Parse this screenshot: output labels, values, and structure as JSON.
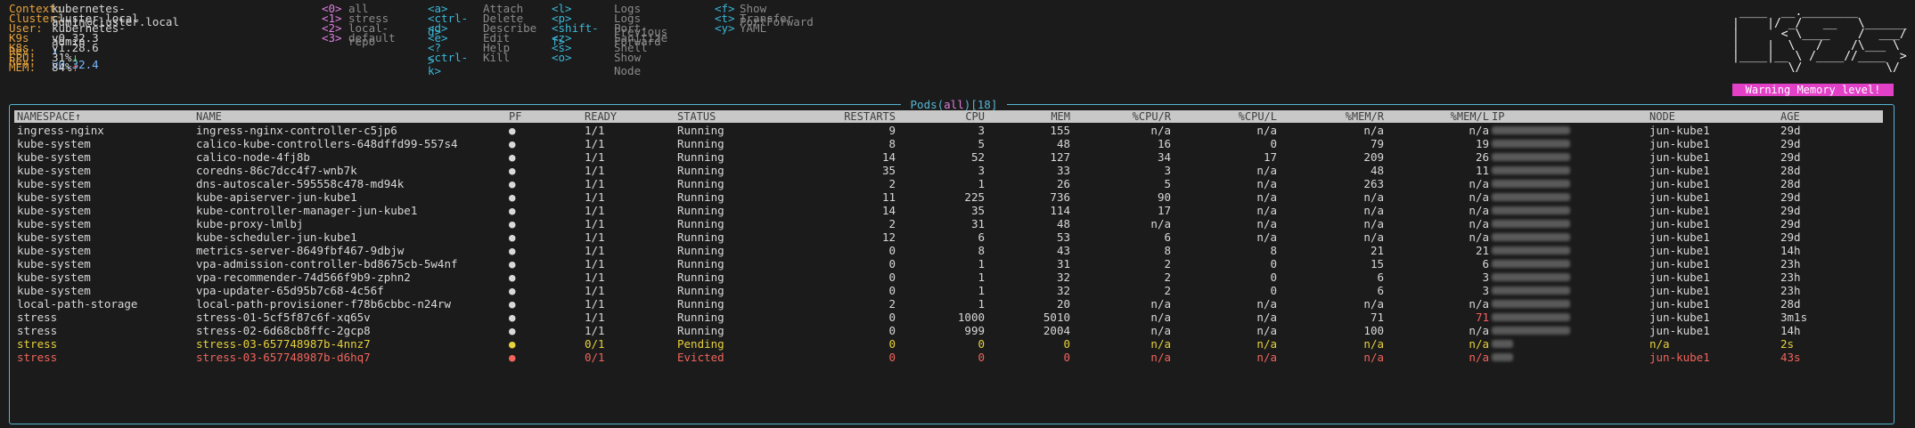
{
  "header": {
    "info": [
      {
        "key": "Context:",
        "value": "kubernetes-admin@cluster.local"
      },
      {
        "key": "Cluster:",
        "value": "cluster.local"
      },
      {
        "key": "User:",
        "value": "kubernetes-admin"
      },
      {
        "key": "K9s Rev:",
        "value": "v0.32.3",
        "extra_glyph": "⬇",
        "extra": "v0.32.4"
      },
      {
        "key": "K8s Rev:",
        "value": "v1.28.6"
      },
      {
        "key": "CPU:",
        "value": "31%",
        "trend": "↓"
      },
      {
        "key": "MEM:",
        "value": "84%",
        "trend": "↑"
      }
    ],
    "namespaces": [
      {
        "key": "<0>",
        "label": "all"
      },
      {
        "key": "<1>",
        "label": "stress"
      },
      {
        "key": "<2>",
        "label": "local-repo"
      },
      {
        "key": "<3>",
        "label": "default"
      }
    ],
    "actions1": [
      {
        "key": "<a>",
        "label": "Attach"
      },
      {
        "key": "<ctrl-d>",
        "label": "Delete"
      },
      {
        "key": "<d>",
        "label": "Describe"
      },
      {
        "key": "<e>",
        "label": "Edit"
      },
      {
        "key": "<?>",
        "label": "Help"
      },
      {
        "key": "<ctrl-k>",
        "label": "Kill"
      }
    ],
    "actions2": [
      {
        "key": "<l>",
        "label": "Logs"
      },
      {
        "key": "<p>",
        "label": "Logs Previous"
      },
      {
        "key": "<shift-f>",
        "label": "Port-Forward"
      },
      {
        "key": "<z>",
        "label": "Sanitize"
      },
      {
        "key": "<s>",
        "label": "Shell"
      },
      {
        "key": "<o>",
        "label": "Show Node"
      }
    ],
    "actions3": [
      {
        "key": "<f>",
        "label": "Show PortForward"
      },
      {
        "key": "<t>",
        "label": "Transfer"
      },
      {
        "key": "<y>",
        "label": "YAML"
      }
    ],
    "logo_lines": [
      " ____  __.________        ",
      "|    |/ _/   __   \\______ ",
      "|      < \\____    /  ___/ ",
      "|    |  \\   /    /\\___ \\  ",
      "|____|__ \\ /____//____  > ",
      "        \\/            \\/  "
    ],
    "warning": "Warning Memory level!"
  },
  "table": {
    "title_pre": " Pods(",
    "title_ns": "all",
    "title_post": ")[18] ",
    "columns": [
      "NAMESPACE↑",
      "NAME",
      "PF",
      "READY",
      "STATUS",
      "RESTARTS",
      "CPU",
      "MEM",
      "%CPU/R",
      "%CPU/L",
      "%MEM/R",
      "%MEM/L",
      "IP",
      "NODE",
      "AGE"
    ],
    "rows": [
      {
        "ns": "ingress-nginx",
        "name": "ingress-nginx-controller-c5jp6",
        "pf": "●",
        "ready": "1/1",
        "status": "Running",
        "restarts": "9",
        "cpu": "3",
        "mem": "155",
        "cpur": "n/a",
        "cpul": "n/a",
        "memr": "n/a",
        "meml": "n/a",
        "node": "jun-kube1",
        "age": "29d",
        "state": "ok"
      },
      {
        "ns": "kube-system",
        "name": "calico-kube-controllers-648dffd99-557s4",
        "pf": "●",
        "ready": "1/1",
        "status": "Running",
        "restarts": "8",
        "cpu": "5",
        "mem": "48",
        "cpur": "16",
        "cpul": "0",
        "memr": "79",
        "meml": "19",
        "node": "jun-kube1",
        "age": "29d",
        "state": "ok"
      },
      {
        "ns": "kube-system",
        "name": "calico-node-4fj8b",
        "pf": "●",
        "ready": "1/1",
        "status": "Running",
        "restarts": "14",
        "cpu": "52",
        "mem": "127",
        "cpur": "34",
        "cpul": "17",
        "memr": "209",
        "meml": "26",
        "node": "jun-kube1",
        "age": "29d",
        "state": "ok"
      },
      {
        "ns": "kube-system",
        "name": "coredns-86c7dcc4f7-wnb7k",
        "pf": "●",
        "ready": "1/1",
        "status": "Running",
        "restarts": "35",
        "cpu": "3",
        "mem": "33",
        "cpur": "3",
        "cpul": "n/a",
        "memr": "48",
        "meml": "11",
        "node": "jun-kube1",
        "age": "28d",
        "state": "ok"
      },
      {
        "ns": "kube-system",
        "name": "dns-autoscaler-595558c478-md94k",
        "pf": "●",
        "ready": "1/1",
        "status": "Running",
        "restarts": "2",
        "cpu": "1",
        "mem": "26",
        "cpur": "5",
        "cpul": "n/a",
        "memr": "263",
        "meml": "n/a",
        "node": "jun-kube1",
        "age": "28d",
        "state": "ok"
      },
      {
        "ns": "kube-system",
        "name": "kube-apiserver-jun-kube1",
        "pf": "●",
        "ready": "1/1",
        "status": "Running",
        "restarts": "11",
        "cpu": "225",
        "mem": "736",
        "cpur": "90",
        "cpul": "n/a",
        "memr": "n/a",
        "meml": "n/a",
        "node": "jun-kube1",
        "age": "29d",
        "state": "ok"
      },
      {
        "ns": "kube-system",
        "name": "kube-controller-manager-jun-kube1",
        "pf": "●",
        "ready": "1/1",
        "status": "Running",
        "restarts": "14",
        "cpu": "35",
        "mem": "114",
        "cpur": "17",
        "cpul": "n/a",
        "memr": "n/a",
        "meml": "n/a",
        "node": "jun-kube1",
        "age": "29d",
        "state": "ok"
      },
      {
        "ns": "kube-system",
        "name": "kube-proxy-lmlbj",
        "pf": "●",
        "ready": "1/1",
        "status": "Running",
        "restarts": "2",
        "cpu": "31",
        "mem": "48",
        "cpur": "n/a",
        "cpul": "n/a",
        "memr": "n/a",
        "meml": "n/a",
        "node": "jun-kube1",
        "age": "29d",
        "state": "ok"
      },
      {
        "ns": "kube-system",
        "name": "kube-scheduler-jun-kube1",
        "pf": "●",
        "ready": "1/1",
        "status": "Running",
        "restarts": "12",
        "cpu": "6",
        "mem": "53",
        "cpur": "6",
        "cpul": "n/a",
        "memr": "n/a",
        "meml": "n/a",
        "node": "jun-kube1",
        "age": "29d",
        "state": "ok"
      },
      {
        "ns": "kube-system",
        "name": "metrics-server-8649fbf467-9dbjw",
        "pf": "●",
        "ready": "1/1",
        "status": "Running",
        "restarts": "0",
        "cpu": "8",
        "mem": "43",
        "cpur": "8",
        "cpul": "8",
        "memr": "21",
        "meml": "21",
        "node": "jun-kube1",
        "age": "14h",
        "state": "ok"
      },
      {
        "ns": "kube-system",
        "name": "vpa-admission-controller-bd8675cb-5w4nf",
        "pf": "●",
        "ready": "1/1",
        "status": "Running",
        "restarts": "0",
        "cpu": "1",
        "mem": "31",
        "cpur": "2",
        "cpul": "0",
        "memr": "15",
        "meml": "6",
        "node": "jun-kube1",
        "age": "23h",
        "state": "ok"
      },
      {
        "ns": "kube-system",
        "name": "vpa-recommender-74d566f9b9-zphn2",
        "pf": "●",
        "ready": "1/1",
        "status": "Running",
        "restarts": "0",
        "cpu": "1",
        "mem": "32",
        "cpur": "2",
        "cpul": "0",
        "memr": "6",
        "meml": "3",
        "node": "jun-kube1",
        "age": "23h",
        "state": "ok"
      },
      {
        "ns": "kube-system",
        "name": "vpa-updater-65d95b7c68-4c56f",
        "pf": "●",
        "ready": "1/1",
        "status": "Running",
        "restarts": "0",
        "cpu": "1",
        "mem": "32",
        "cpur": "2",
        "cpul": "0",
        "memr": "6",
        "meml": "3",
        "node": "jun-kube1",
        "age": "23h",
        "state": "ok"
      },
      {
        "ns": "local-path-storage",
        "name": "local-path-provisioner-f78b6cbbc-n24rw",
        "pf": "●",
        "ready": "1/1",
        "status": "Running",
        "restarts": "2",
        "cpu": "1",
        "mem": "20",
        "cpur": "n/a",
        "cpul": "n/a",
        "memr": "n/a",
        "meml": "n/a",
        "node": "jun-kube1",
        "age": "28d",
        "state": "ok"
      },
      {
        "ns": "stress",
        "name": "stress-01-5cf5f87c6f-xq65v",
        "pf": "●",
        "ready": "1/1",
        "status": "Running",
        "restarts": "0",
        "cpu": "1000",
        "mem": "5010",
        "cpur": "n/a",
        "cpul": "n/a",
        "memr": "71",
        "meml": "71",
        "node": "jun-kube1",
        "age": "3m1s",
        "state": "ok",
        "meml_hot": true
      },
      {
        "ns": "stress",
        "name": "stress-02-6d68cb8ffc-2gcp8",
        "pf": "●",
        "ready": "1/1",
        "status": "Running",
        "restarts": "0",
        "cpu": "999",
        "mem": "2004",
        "cpur": "n/a",
        "cpul": "n/a",
        "memr": "100",
        "meml": "n/a",
        "node": "jun-kube1",
        "age": "14h",
        "state": "ok"
      },
      {
        "ns": "stress",
        "name": "stress-03-657748987b-4nnz7",
        "pf": "●",
        "ready": "0/1",
        "status": "Pending",
        "restarts": "0",
        "cpu": "0",
        "mem": "0",
        "cpur": "n/a",
        "cpul": "n/a",
        "memr": "n/a",
        "meml": "n/a",
        "node": "n/a",
        "age": "2s",
        "state": "pending"
      },
      {
        "ns": "stress",
        "name": "stress-03-657748987b-d6hq7",
        "pf": "●",
        "ready": "0/1",
        "status": "Evicted",
        "restarts": "0",
        "cpu": "0",
        "mem": "0",
        "cpur": "n/a",
        "cpul": "n/a",
        "memr": "n/a",
        "meml": "n/a",
        "node": "jun-kube1",
        "age": "43s",
        "state": "evicted"
      }
    ]
  },
  "colors": {
    "background": "#1b1b1b",
    "key_orange": "#e6a23c",
    "key_magenta": "#e07ee0",
    "key_cyan": "#3ab7d8",
    "frame": "#56b6d4",
    "warning_bg": "#e140c7",
    "pending": "#e7d13c",
    "evicted": "#f0645c"
  }
}
